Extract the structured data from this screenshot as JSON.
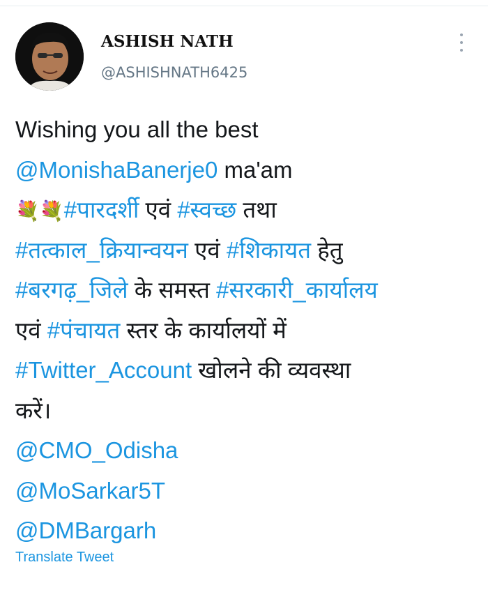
{
  "user": {
    "name": "ASHISH NATH",
    "handle": "@ASHISHNATH6425",
    "avatar": "profile-photo"
  },
  "menu_icon": "three-dot-vertical-icon",
  "tweet": {
    "l1": "Wishing you all the best",
    "l2_mention": "@MonishaBanerje0",
    "l2_text": " ma'am",
    "l3_flowers": "💐💐",
    "l3_tag1": "#पारदर्शी",
    "l3_text1": " एवं ",
    "l3_tag2": "#स्वच्छ",
    "l3_text2": " तथा",
    "l4_tag1": "#तत्काल_क्रियान्वयन",
    "l4_text1": " एवं ",
    "l4_tag2": "#शिकायत",
    "l4_text2": " हेतु",
    "l5_tag1": "#बरगढ़_जिले",
    "l5_text1": " के समस्त ",
    "l5_tag2": "#सरकारी_कार्यालय",
    "l6_text1": "एवं ",
    "l6_tag1": "#पंचायत",
    "l6_text2": " स्तर के कार्यालयों में",
    "l7_tag1": "#Twitter_Account",
    "l7_text1": " खोलने की व्यवस्था",
    "l8_text1": "करें।",
    "m1": "@CMO_Odisha",
    "m2": "@MoSarkar5T",
    "m3": "@DMBargarh"
  },
  "translate_label": "Translate Tweet",
  "colors": {
    "link": "#1b95e0",
    "text": "#14171a",
    "secondary": "#657786"
  }
}
